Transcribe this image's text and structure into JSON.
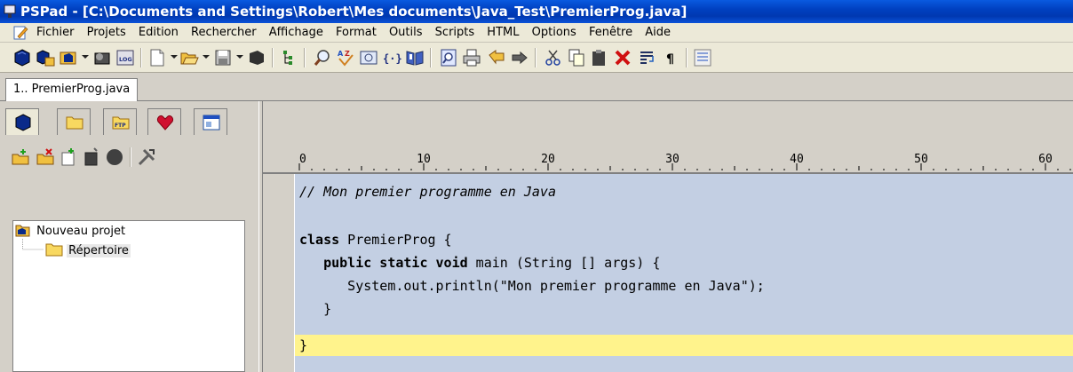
{
  "window": {
    "title": "PSPad - [C:\\Documents and Settings\\Robert\\Mes documents\\Java_Test\\PremierProg.java]"
  },
  "menu": {
    "items": [
      "Fichier",
      "Projets",
      "Edition",
      "Rechercher",
      "Affichage",
      "Format",
      "Outils",
      "Scripts",
      "HTML",
      "Options",
      "Fenêtre",
      "Aide"
    ]
  },
  "toolbar": {
    "icons": [
      "project-icon",
      "open-project-icon",
      "open-project-dropdown-icon",
      "ftp-icon",
      "log-icon",
      "new-file-icon",
      "open-file-icon",
      "save-icon",
      "close-icon",
      "tree-icon",
      "find-icon",
      "spellcheck-icon",
      "preview-icon",
      "code-icon",
      "book-icon",
      "search-file-icon",
      "print-icon",
      "undo-icon",
      "redo-icon",
      "cut-icon",
      "copy-icon",
      "paste-icon",
      "delete-icon",
      "wrap-icon",
      "pilcrow-icon",
      "column-icon"
    ]
  },
  "tabs": {
    "documents": [
      "1.. PremierProg.java"
    ]
  },
  "panel": {
    "tabs": [
      "project-tab",
      "files-tab",
      "ftp-tab",
      "favorites-tab",
      "clips-tab"
    ],
    "tree": {
      "project": "Nouveau projet",
      "folder": "Répertoire"
    }
  },
  "ruler": {
    "labels": [
      "0",
      "10",
      "20",
      "30",
      "40",
      "50",
      "60"
    ]
  },
  "editor": {
    "lines": [
      "// Mon premier programme en Java",
      "",
      "class PremierProg {",
      "   public static void main (String [] args) {",
      "      System.out.println(\"Mon premier programme en Java\");",
      "   }",
      "}"
    ],
    "line_kw": {
      "l3_kw": "class",
      "l3_rest": " PremierProg {",
      "l4_indent": "   ",
      "l4_kw": "public static void",
      "l4_rest": " main (String [] args) {",
      "l5": "      System.out.println(\"Mon premier programme en Java\");",
      "l6": "   }",
      "l7": "}"
    },
    "colors": {
      "selection": "#c3cfe3",
      "current_line": "#fff38c"
    }
  }
}
